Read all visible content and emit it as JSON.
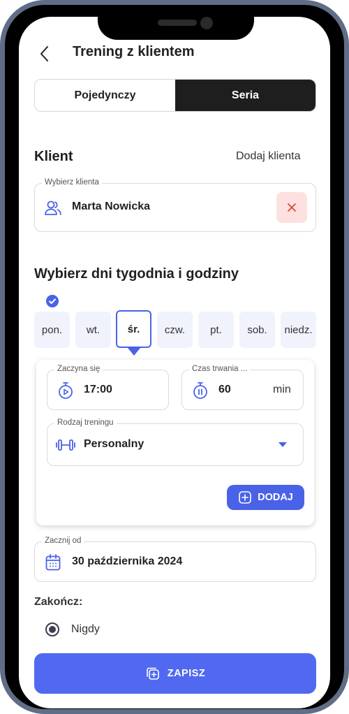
{
  "header": {
    "title": "Trening z klientem"
  },
  "mode_tabs": [
    {
      "label": "Pojedynczy",
      "active": false
    },
    {
      "label": "Seria",
      "active": true
    }
  ],
  "client": {
    "heading": "Klient",
    "add_label": "Dodaj klienta",
    "field_label": "Wybierz klienta",
    "value": "Marta Nowicka"
  },
  "days": {
    "heading": "Wybierz dni tygodnia i godziny",
    "items": [
      {
        "label": "pon.",
        "checked": true,
        "selected": false
      },
      {
        "label": "wt.",
        "checked": false,
        "selected": false
      },
      {
        "label": "śr.",
        "checked": false,
        "selected": true
      },
      {
        "label": "czw.",
        "checked": false,
        "selected": false
      },
      {
        "label": "pt.",
        "checked": false,
        "selected": false
      },
      {
        "label": "sob.",
        "checked": false,
        "selected": false
      },
      {
        "label": "niedz.",
        "checked": false,
        "selected": false
      }
    ]
  },
  "slot": {
    "start_label": "Zaczyna się",
    "start_value": "17:00",
    "duration_label": "Czas trwania ...",
    "duration_value": "60",
    "duration_unit": "min",
    "type_label": "Rodzaj treningu",
    "type_value": "Personalny",
    "add_button": "DODAJ"
  },
  "start_date": {
    "label": "Zacznij od",
    "value": "30 października 2024"
  },
  "end": {
    "heading": "Zakończ:",
    "option": "Nigdy",
    "selected": true
  },
  "save_button": "ZAPISZ",
  "colors": {
    "accent": "#4a62e8",
    "save": "#5069f0",
    "danger_bg": "#fde0e0",
    "danger": "#e0453a",
    "dark_tab": "#1e1e1e"
  }
}
